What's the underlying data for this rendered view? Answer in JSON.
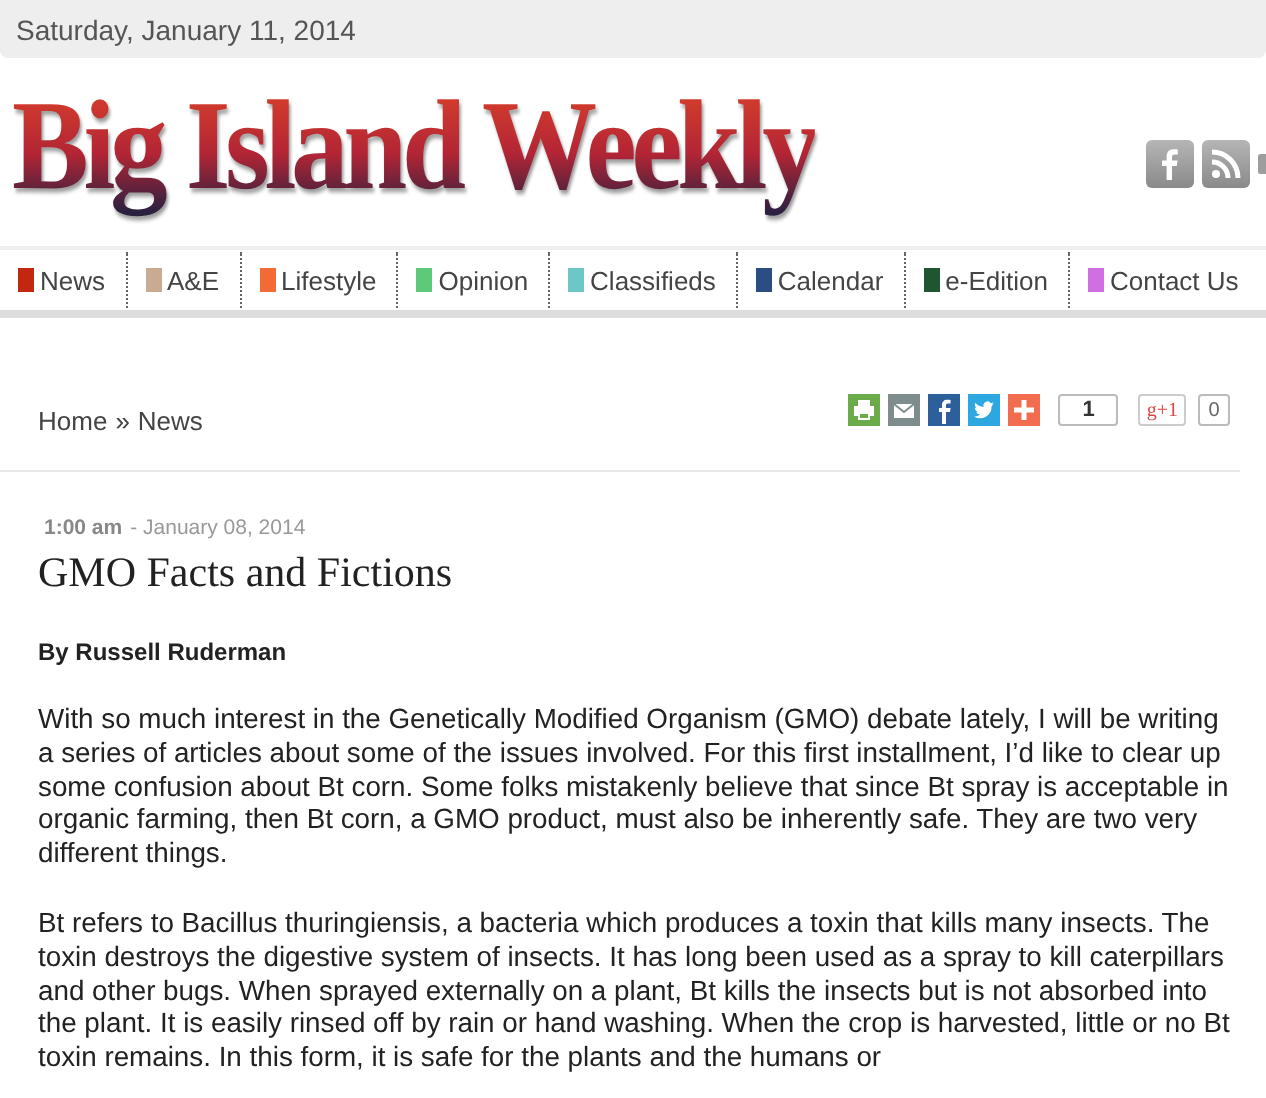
{
  "date": "Saturday, January 11, 2014",
  "logo": "Big Island Weekly",
  "nav": [
    {
      "label": "News",
      "color": "#c1280f"
    },
    {
      "label": "A&E",
      "color": "#c9ab93"
    },
    {
      "label": "Lifestyle",
      "color": "#f26a35"
    },
    {
      "label": "Opinion",
      "color": "#5fc97a"
    },
    {
      "label": "Classifieds",
      "color": "#6cc7c9"
    },
    {
      "label": "Calendar",
      "color": "#2a4d84"
    },
    {
      "label": "e-Edition",
      "color": "#1f5530"
    },
    {
      "label": "Contact Us",
      "color": "#cf6fe0"
    }
  ],
  "breadcrumb": [
    {
      "label": "Home"
    },
    {
      "label": "News"
    }
  ],
  "breadcrumb_separator": "»",
  "share": {
    "like_count": "1",
    "gplus_label": "g+1",
    "gplus_count": "0"
  },
  "article": {
    "time": "1:00 am",
    "date": "- January 08, 2014",
    "title": "GMO Facts and Fictions",
    "byline": "By Russell Ruderman",
    "paragraphs": [
      "With so much interest in the Genetically Modified Organism (GMO) debate lately, I will be writing a series of articles about some of the issues involved. For this first installment, I’d like to clear up some confusion about Bt corn. Some folks mistakenly believe that since Bt spray is acceptable in organic farming, then Bt corn, a GMO product, must also be inherently safe. They are two very different things.",
      "Bt refers to Bacillus thuringiensis, a bacteria which produces a toxin that kills many insects. The toxin destroys the digestive system of insects. It has long been used as a spray to kill caterpillars and other bugs. When sprayed externally on a plant, Bt kills the insects but is not absorbed into the plant. It is easily rinsed off by rain or hand washing. When the crop is harvested, little or no Bt toxin remains. In this form, it is safe for the plants and the humans or"
    ]
  }
}
